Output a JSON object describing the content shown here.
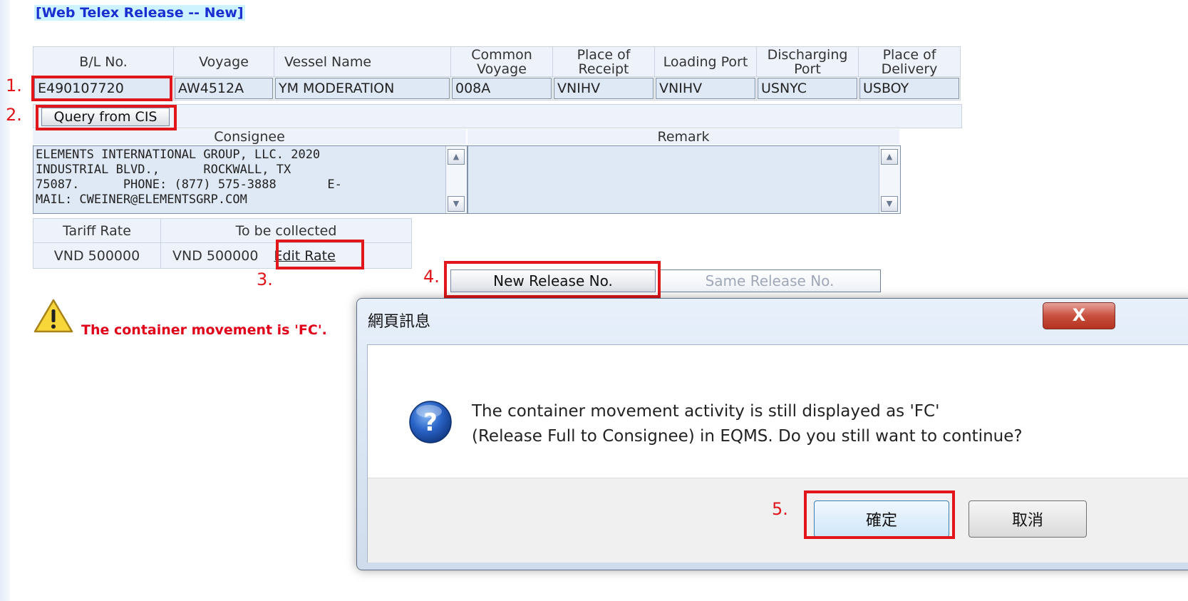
{
  "page": {
    "title": "[Web Telex Release -- New]"
  },
  "bl_table": {
    "headers": [
      "B/L No.",
      "Voyage",
      "Vessel Name",
      "Common Voyage",
      "Place of Receipt",
      "Loading Port",
      "Discharging Port",
      "Place of Delivery"
    ],
    "values": [
      "E490107720",
      "AW4512A",
      "YM MODERATION",
      "008A",
      "VNIHV",
      "VNIHV",
      "USNYC",
      "USBOY"
    ]
  },
  "query_button": "Query from CIS",
  "consignee": {
    "label": "Consignee",
    "text": "ELEMENTS INTERNATIONAL GROUP, LLC. 2020\nINDUSTRIAL BLVD.,      ROCKWALL, TX\n75087.      PHONE: (877) 575-3888       E-\nMAIL: CWEINER@ELEMENTSGRP.COM"
  },
  "remark": {
    "label": "Remark",
    "text": ""
  },
  "rate": {
    "tariff_label": "Tariff Rate",
    "collect_label": "To be collected",
    "tariff_value": "VND 500000",
    "collect_value": "VND 500000",
    "edit_link": "Edit Rate"
  },
  "buttons": {
    "new_release": "New Release No.",
    "same_release": "Same Release No."
  },
  "warning": {
    "text": "The container movement is 'FC'."
  },
  "annotations": [
    "1.",
    "2.",
    "3.",
    "4.",
    "5."
  ],
  "dialog": {
    "title": "網頁訊息",
    "close": "X",
    "message_line1": "The container movement activity is still displayed as 'FC'",
    "message_line2": "(Release Full to Consignee) in EQMS. Do you still want to continue?",
    "ok": "確定",
    "cancel": "取消"
  },
  "colors": {
    "annotation": "#e0161a",
    "warning": "#e1001a",
    "title": "#1a2fd1"
  }
}
